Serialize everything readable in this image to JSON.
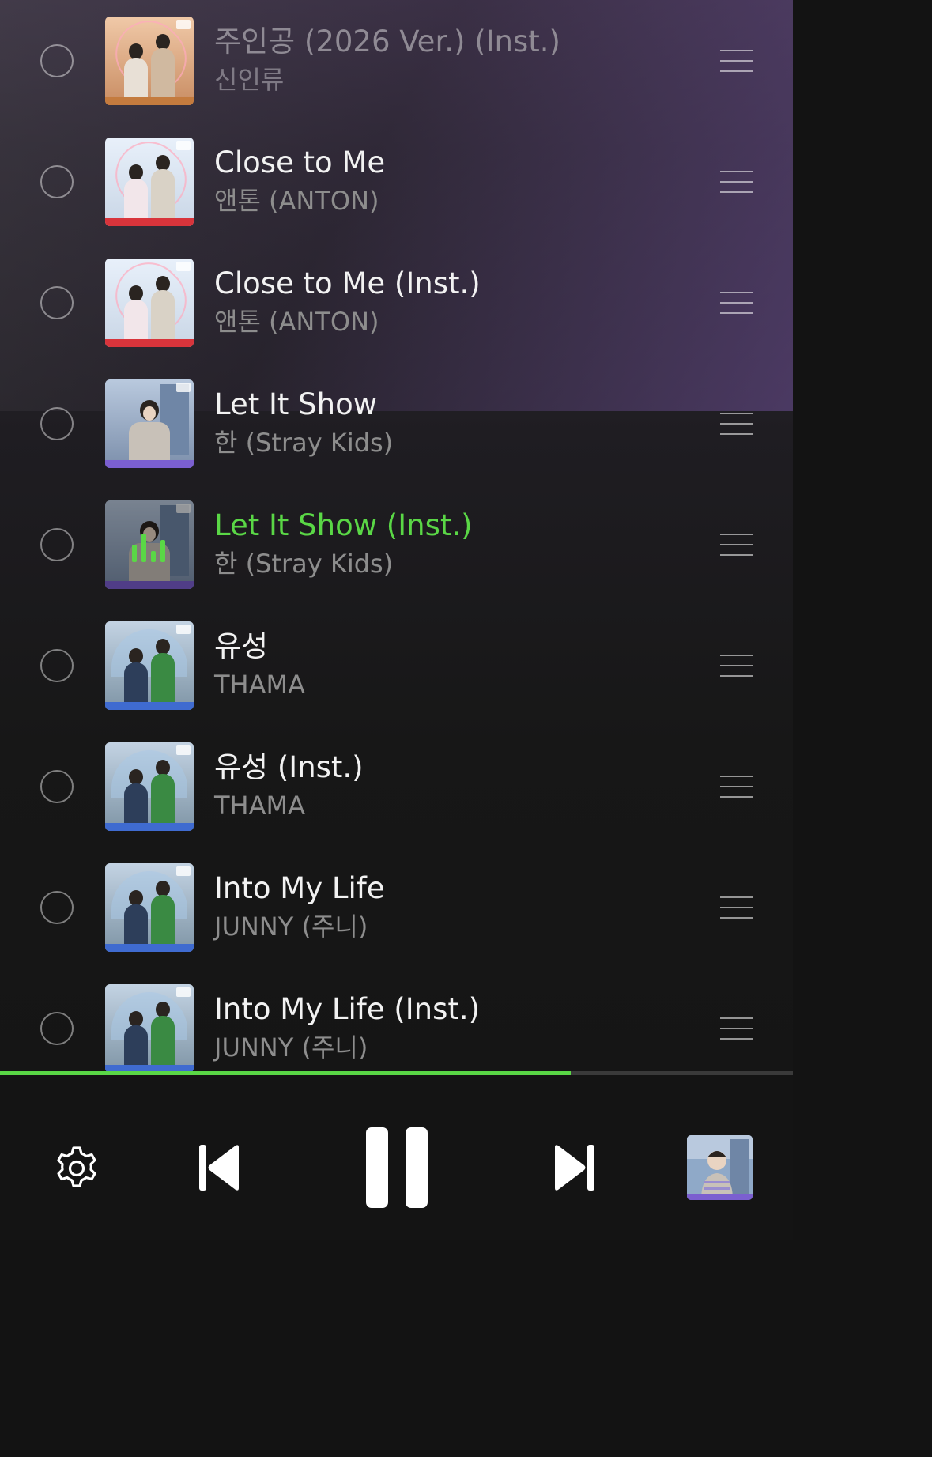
{
  "playlist": [
    {
      "title": "주인공 (2026 Ver.) (Inst.)",
      "artist": "신인류",
      "art": "heart-couple-orange",
      "state": "dim"
    },
    {
      "title": "Close to Me",
      "artist": "앤톤 (ANTON)",
      "art": "heart-couple-sky",
      "state": "normal"
    },
    {
      "title": "Close to Me (Inst.)",
      "artist": "앤톤 (ANTON)",
      "art": "heart-couple-sky",
      "state": "normal"
    },
    {
      "title": "Let It Show",
      "artist": "한 (Stray Kids)",
      "art": "street-boy-purple",
      "state": "normal"
    },
    {
      "title": "Let It Show (Inst.)",
      "artist": "한 (Stray Kids)",
      "art": "street-boy-purple",
      "state": "playing"
    },
    {
      "title": "유성",
      "artist": "THAMA",
      "art": "umbrella-couple-teal",
      "state": "normal"
    },
    {
      "title": "유성 (Inst.)",
      "artist": "THAMA",
      "art": "umbrella-couple-teal",
      "state": "normal"
    },
    {
      "title": "Into My Life",
      "artist": "JUNNY (주니)",
      "art": "umbrella-couple-teal",
      "state": "normal"
    },
    {
      "title": "Into My Life (Inst.)",
      "artist": "JUNNY (주니)",
      "art": "umbrella-couple-teal",
      "state": "normal"
    }
  ],
  "player": {
    "progress_fraction": 0.72,
    "state": "playing",
    "accent_color": "#5ad746",
    "icons": {
      "settings": "gear-icon",
      "previous": "skip-previous-icon",
      "play_pause": "pause-icon",
      "next": "skip-next-icon",
      "now_playing_art": "album-art-thumbnail"
    }
  }
}
